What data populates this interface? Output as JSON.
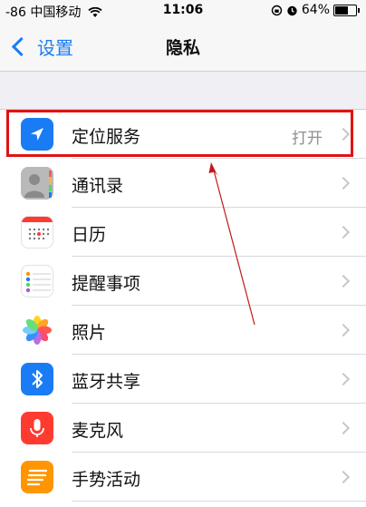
{
  "status": {
    "carrier": "-86 中国移动",
    "time": "11:06",
    "battery_text": "64%",
    "battery_level": 0.64
  },
  "nav": {
    "back_label": "设置",
    "title": "隐私"
  },
  "rows": [
    {
      "label": "定位服务",
      "value": "打开",
      "icon": "location-arrow-icon"
    },
    {
      "label": "通讯录",
      "value": "",
      "icon": "contacts-icon"
    },
    {
      "label": "日历",
      "value": "",
      "icon": "calendar-icon"
    },
    {
      "label": "提醒事项",
      "value": "",
      "icon": "reminders-icon"
    },
    {
      "label": "照片",
      "value": "",
      "icon": "photos-icon"
    },
    {
      "label": "蓝牙共享",
      "value": "",
      "icon": "bluetooth-icon"
    },
    {
      "label": "麦克风",
      "value": "",
      "icon": "microphone-icon"
    },
    {
      "label": "手势活动",
      "value": "",
      "icon": "motion-activity-icon"
    }
  ],
  "colors": {
    "accent": "#1a7cf5",
    "highlight": "#e01313"
  }
}
